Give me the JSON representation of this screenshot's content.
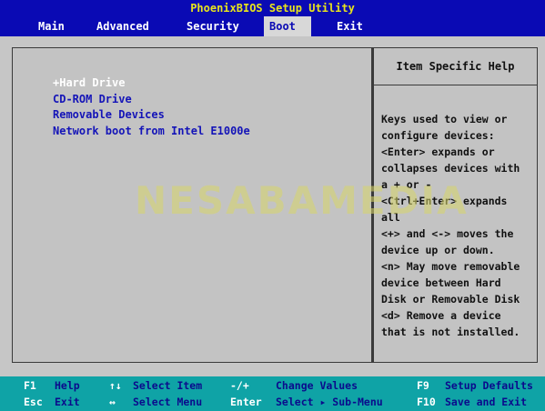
{
  "title": "PhoenixBIOS Setup Utility",
  "menu": {
    "items": [
      {
        "label": "Main"
      },
      {
        "label": "Advanced"
      },
      {
        "label": "Security"
      },
      {
        "label": "Boot"
      },
      {
        "label": "Exit"
      }
    ],
    "active": "Boot"
  },
  "boot": {
    "items": [
      {
        "label": "+Hard Drive"
      },
      {
        "label": "CD-ROM Drive"
      },
      {
        "label": "Removable Devices"
      },
      {
        "label": "Network boot from Intel E1000e"
      }
    ],
    "selected": "+Hard Drive"
  },
  "help": {
    "title": "Item Specific Help",
    "lines": [
      "Keys used to view or",
      "configure devices:",
      "<Enter> expands or",
      "collapses devices with",
      "a + or -",
      "<Ctrl+Enter> expands",
      "all",
      "<+> and <-> moves the",
      "device up or down.",
      "<n> May move removable",
      "device between Hard",
      "Disk or Removable Disk",
      "<d> Remove a device",
      "that is not installed."
    ]
  },
  "watermark": "NESABAMEDIA",
  "footer": {
    "row1": {
      "k1": "F1",
      "d1": "Help",
      "k2": "↑↓",
      "d2": "Select Item",
      "k3": "-/+",
      "d3": "Change Values",
      "k4": "F9",
      "d4": "Setup Defaults"
    },
    "row2": {
      "k1": "Esc",
      "d1": "Exit",
      "k2": "↔",
      "d2": "Select Menu",
      "k3": "Enter",
      "d3": "Select ▸ Sub-Menu",
      "k4": "F10",
      "d4": "Save and Exit"
    }
  },
  "colors": {
    "bios_blue": "#0a0ab4",
    "panel_gray": "#c3c3c3",
    "footer_teal": "#0fa3a6",
    "title_yellow": "#e8e41c"
  }
}
